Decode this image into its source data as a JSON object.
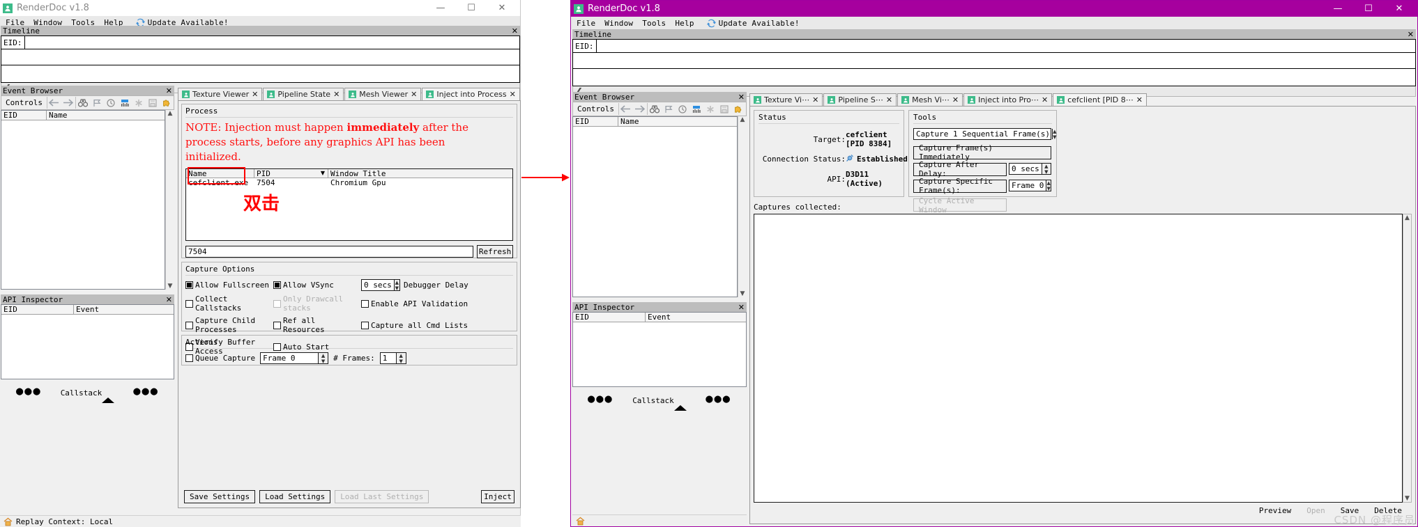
{
  "app": {
    "title": "RenderDoc v1.8",
    "icon": "renderdoc-app-icon"
  },
  "window_buttons": {
    "minimize": "—",
    "maximize": "☐",
    "close": "✕"
  },
  "menu": {
    "items": [
      "File",
      "Window",
      "Tools",
      "Help"
    ],
    "update_label": "Update Available!",
    "update_icon": "refresh-icon"
  },
  "timeline": {
    "caption": "Timeline",
    "close": "✕",
    "eid_label": "EID:",
    "eid_value": ""
  },
  "event_browser": {
    "caption": "Event Browser",
    "close": "✕",
    "controls_label": "Controls",
    "toolbar_icons": [
      "back-arrow-icon",
      "forward-arrow-icon",
      "binoculars-icon",
      "flag-icon",
      "clock-icon",
      "bar-chart-icon",
      "asterisk-icon",
      "save-icon",
      "puzzle-icon"
    ],
    "columns": [
      "EID",
      "Name"
    ],
    "rows": []
  },
  "api_inspector": {
    "caption": "API Inspector",
    "close": "✕",
    "columns": [
      "EID",
      "Event"
    ],
    "rows": [],
    "callstack_label": "Callstack",
    "dots": "●●●"
  },
  "statusbar": {
    "icon": "home-icon",
    "text": "Replay Context: Local"
  },
  "left_window": {
    "tabs": [
      {
        "label": "Texture Viewer",
        "icon": "renderdoc-tab-icon",
        "close": "✕",
        "active": false
      },
      {
        "label": "Pipeline State",
        "icon": "renderdoc-tab-icon",
        "close": "✕",
        "active": false
      },
      {
        "label": "Mesh Viewer",
        "icon": "renderdoc-tab-icon",
        "close": "✕",
        "active": false
      },
      {
        "label": "Inject into Process",
        "icon": "renderdoc-tab-icon",
        "close": "✕",
        "active": true
      }
    ],
    "process_group": {
      "caption": "Process",
      "note_line1_a": "NOTE: Injection must happen ",
      "note_line1_b": "immediately",
      "note_line1_c": " after the",
      "note_line2": "process starts, before any graphics API has been",
      "note_line3": "initialized.",
      "columns": [
        "Name",
        "PID",
        "Window Title"
      ],
      "sort_icon": "chevron-down-icon",
      "rows": [
        {
          "name": "cefclient.exe",
          "pid": "7504",
          "window_title": "Chromium Gpu"
        }
      ],
      "annotation_cn": "双击",
      "filter_value": "7504",
      "refresh_label": "Refresh"
    },
    "capture_options": {
      "caption": "Capture Options",
      "checkboxes": [
        {
          "label": "Allow Fullscreen",
          "checked": true,
          "disabled": false
        },
        {
          "label": "Allow VSync",
          "checked": true,
          "disabled": false
        },
        {
          "label": "Collect Callstacks",
          "checked": false,
          "disabled": false
        },
        {
          "label": "Only Drawcall stacks",
          "checked": false,
          "disabled": true
        },
        {
          "label": "Enable API Validation",
          "checked": false,
          "disabled": false
        },
        {
          "label": "Capture Child Processes",
          "checked": false,
          "disabled": false
        },
        {
          "label": "Ref all Resources",
          "checked": false,
          "disabled": false
        },
        {
          "label": "Capture all Cmd Lists",
          "checked": false,
          "disabled": false
        },
        {
          "label": "Verify Buffer Access",
          "checked": false,
          "disabled": false
        },
        {
          "label": "Auto Start",
          "checked": false,
          "disabled": false
        }
      ],
      "delay_value": "0 secs",
      "delay_label": "Debugger Delay"
    },
    "actions": {
      "caption": "Actions",
      "queue_capture_label": "Queue Capture",
      "queue_capture_checked": false,
      "frame_value": "Frame 0",
      "frames_label": "# Frames:",
      "frames_value": "1"
    },
    "buttons": {
      "save_settings": "Save Settings",
      "load_settings": "Load Settings",
      "load_last_settings": "Load Last Settings",
      "inject": "Inject"
    }
  },
  "right_window": {
    "tabs": [
      {
        "label": "Texture Vi⋯",
        "icon": "renderdoc-tab-icon",
        "close": "✕",
        "active": false
      },
      {
        "label": "Pipeline S⋯",
        "icon": "renderdoc-tab-icon",
        "close": "✕",
        "active": false
      },
      {
        "label": "Mesh Vi⋯",
        "icon": "renderdoc-tab-icon",
        "close": "✕",
        "active": false
      },
      {
        "label": "Inject into Pro⋯",
        "icon": "renderdoc-tab-icon",
        "close": "✕",
        "active": false
      },
      {
        "label": "cefclient [PID 8⋯",
        "icon": "renderdoc-tab-icon",
        "close": "✕",
        "active": true
      }
    ],
    "status_group": {
      "caption": "Status",
      "target_key": "Target:",
      "target_value": "cefclient [PID 8384]",
      "connection_key": "Connection Status:",
      "connection_value": "Established",
      "connection_icon": "plug-icon",
      "api_key": "API:",
      "api_value": "D3D11 (Active)"
    },
    "tools_group": {
      "caption": "Tools",
      "sequential_frames_value": "Capture 1 Sequential Frame(s)",
      "capture_immediately": "Capture Frame(s) Immediately",
      "capture_after_delay": "Capture After Delay:",
      "delay_value": "0 secs",
      "capture_specific": "Capture Specific Frame(s):",
      "specific_value": "Frame 0",
      "cycle_active_window": "Cycle Active Window"
    },
    "captures": {
      "caption": "Captures collected:",
      "rows": [],
      "footer_buttons": [
        {
          "label": "Preview",
          "disabled": false
        },
        {
          "label": "Open",
          "disabled": true
        },
        {
          "label": "Save",
          "disabled": false
        },
        {
          "label": "Delete",
          "disabled": false
        }
      ]
    }
  },
  "watermark": "CSDN @程序员"
}
